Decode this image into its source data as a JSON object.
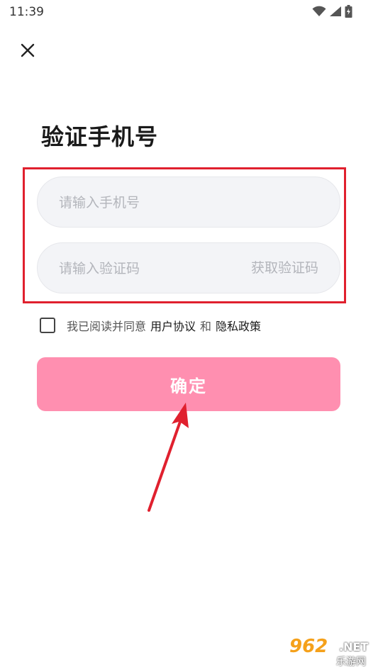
{
  "status_bar": {
    "time": "11:39",
    "icons": [
      "wifi-icon",
      "signal-icon",
      "battery-icon"
    ]
  },
  "header": {
    "close_icon": "close-icon"
  },
  "title": "验证手机号",
  "form": {
    "phone_placeholder": "请输入手机号",
    "code_placeholder": "请输入验证码",
    "get_code_label": "获取验证码"
  },
  "agreement": {
    "prefix": "我已阅读并同意",
    "user_agreement": "用户协议",
    "and": "和",
    "privacy_policy": "隐私政策",
    "checked": false
  },
  "confirm_label": "确定",
  "colors": {
    "accent": "#ff8fb0",
    "annotation_red": "#e0202e",
    "field_bg": "#f3f4f7",
    "placeholder": "#b3b5bb"
  },
  "watermark": {
    "brand": "962",
    "domain": ".NET",
    "sub": "乐游网"
  }
}
